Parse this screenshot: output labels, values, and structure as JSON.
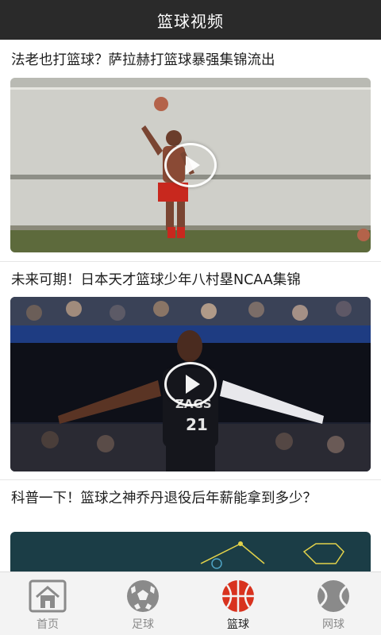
{
  "header": {
    "title": "篮球视频"
  },
  "feed": {
    "items": [
      {
        "title": "法老也打篮球？萨拉赫打篮球暴强集锦流出"
      },
      {
        "title": "未来可期！日本天才篮球少年八村塁NCAA集锦"
      },
      {
        "title": "科普一下！篮球之神乔丹退役后年薪能拿到多少？"
      }
    ],
    "thumb2_jersey": {
      "team": "ZAGS",
      "number": "21"
    }
  },
  "tabbar": {
    "tabs": [
      {
        "label": "首页",
        "icon": "home-icon",
        "active": false
      },
      {
        "label": "足球",
        "icon": "soccer-ball-icon",
        "active": false
      },
      {
        "label": "篮球",
        "icon": "basketball-icon",
        "active": true
      },
      {
        "label": "网球",
        "icon": "tennis-ball-icon",
        "active": false
      }
    ]
  },
  "colors": {
    "header_bg": "#2a2a2a",
    "active_icon": "#d8321e",
    "inactive_icon": "#8a8a8a"
  }
}
